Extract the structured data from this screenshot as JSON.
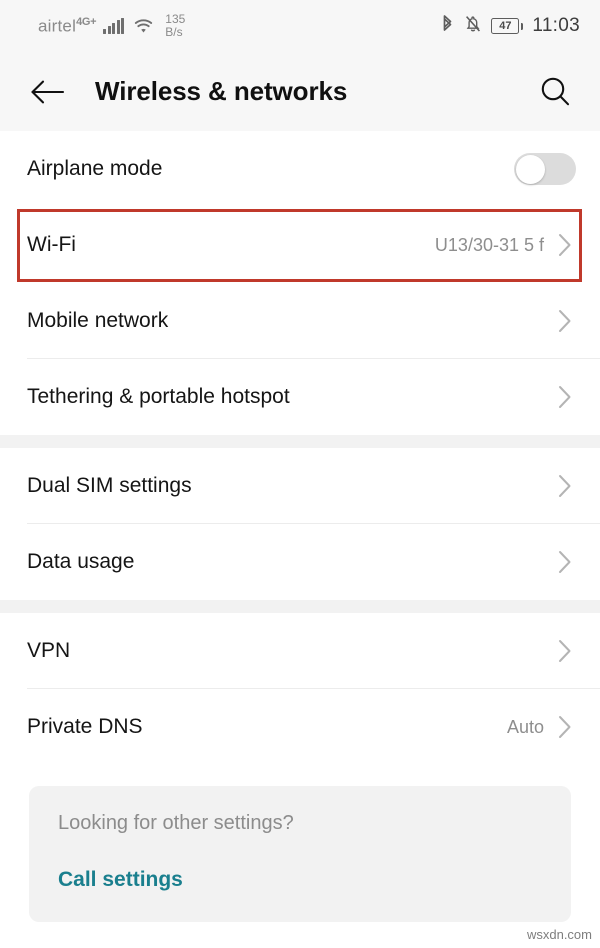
{
  "status_bar": {
    "carrier": "airtel",
    "network_generation": "4G+",
    "signal_icon": "signal-bars-icon",
    "wifi_icon": "wifi-icon",
    "network_speed_value": "135",
    "network_speed_unit": "B/s",
    "bluetooth_icon": "bluetooth-icon",
    "mute_icon": "bell-muted-icon",
    "battery_level": "47",
    "time": "11:03"
  },
  "app_bar": {
    "back_icon": "arrow-left-icon",
    "title": "Wireless & networks",
    "search_icon": "search-icon"
  },
  "colors": {
    "highlight_border": "#c0392b",
    "link_teal": "#1a7f8e",
    "band_gray": "#f2f2f2",
    "toggle_track_off": "#dcdcdc"
  },
  "groups": [
    {
      "rows": [
        {
          "label": "Airplane mode",
          "type": "toggle",
          "toggle_state": "off",
          "value": "",
          "highlighted": false,
          "divider": false
        },
        {
          "label": "Wi-Fi",
          "type": "value",
          "value": "U13/30-31 5 f",
          "highlighted": true,
          "divider": false
        },
        {
          "label": "Mobile network",
          "type": "chevron",
          "value": "",
          "highlighted": false,
          "divider": true
        },
        {
          "label": "Tethering & portable hotspot",
          "type": "chevron",
          "value": "",
          "highlighted": false,
          "divider": false
        }
      ]
    },
    {
      "rows": [
        {
          "label": "Dual SIM settings",
          "type": "chevron",
          "value": "",
          "highlighted": false,
          "divider": true
        },
        {
          "label": "Data usage",
          "type": "chevron",
          "value": "",
          "highlighted": false,
          "divider": false
        }
      ]
    },
    {
      "rows": [
        {
          "label": "VPN",
          "type": "chevron",
          "value": "",
          "highlighted": false,
          "divider": true
        },
        {
          "label": "Private DNS",
          "type": "value",
          "value": "Auto",
          "highlighted": false,
          "divider": false
        }
      ]
    }
  ],
  "footer": {
    "question": "Looking for other settings?",
    "link": "Call settings"
  },
  "watermark": "wsxdn.com"
}
